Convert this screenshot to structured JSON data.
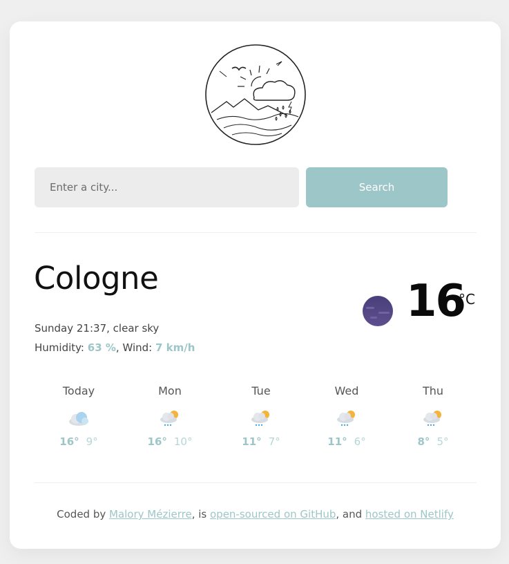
{
  "search": {
    "placeholder": "Enter a city...",
    "button_label": "Search"
  },
  "current": {
    "city": "Cologne",
    "day_time": "Sunday 21:37",
    "description": "clear sky",
    "humidity_label": "Humidity:",
    "humidity_value": "63 %",
    "wind_label": "Wind:",
    "wind_value": "7 km/h",
    "temperature": "16",
    "unit": "°C",
    "icon": "moon-night-icon"
  },
  "forecast": [
    {
      "day": "Today",
      "max": "16°",
      "min": "9°",
      "icon": "cloud-icon"
    },
    {
      "day": "Mon",
      "max": "16°",
      "min": "10°",
      "icon": "sun-cloud-rain-icon"
    },
    {
      "day": "Tue",
      "max": "11°",
      "min": "7°",
      "icon": "sun-cloud-rain-icon"
    },
    {
      "day": "Wed",
      "max": "11°",
      "min": "6°",
      "icon": "sun-cloud-rain-icon"
    },
    {
      "day": "Thu",
      "max": "8°",
      "min": "5°",
      "icon": "sun-cloud-rain-icon"
    }
  ],
  "footer": {
    "coded_by": "Coded by ",
    "author": "Malory Mézierre",
    "is": ", is ",
    "github": "open-sourced on GitHub",
    "and": ", and ",
    "netlify": "hosted on Netlify"
  },
  "colors": {
    "accent": "#9dc6c9",
    "moon": "#4f4478"
  }
}
